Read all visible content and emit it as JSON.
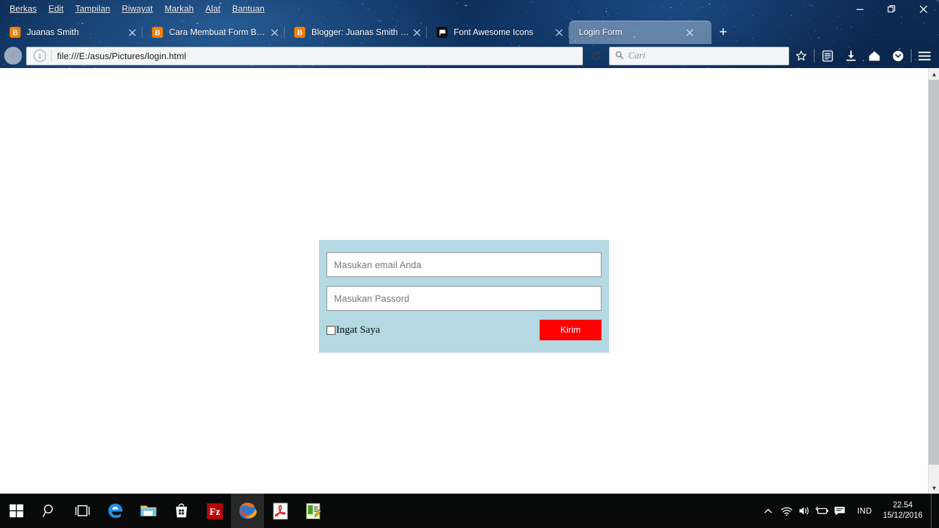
{
  "window": {
    "menus": [
      {
        "label": "Berkas",
        "accel": "B"
      },
      {
        "label": "Edit",
        "accel": "E"
      },
      {
        "label": "Tampilan",
        "accel": "T"
      },
      {
        "label": "Riwayat",
        "accel": "R"
      },
      {
        "label": "Markah",
        "accel": "M"
      },
      {
        "label": "Alat",
        "accel": "A"
      },
      {
        "label": "Bantuan",
        "accel": "n"
      }
    ],
    "controls": {
      "minimize": "minimize-icon",
      "restore": "restore-icon",
      "close": "close-icon"
    }
  },
  "tabs": [
    {
      "title": "Juanas Smith",
      "favicon": "blogger-icon",
      "active": false
    },
    {
      "title": "Cara Membuat Form Bead...",
      "favicon": "blogger-icon",
      "active": false
    },
    {
      "title": "Blogger: Juanas Smith - T...",
      "favicon": "blogger-icon",
      "active": false
    },
    {
      "title": "Font Awesome Icons",
      "favicon": "flag-icon",
      "active": false
    },
    {
      "title": "Login Form",
      "favicon": "none",
      "active": true
    }
  ],
  "newtab_label": "+",
  "toolbar": {
    "back_icon": "back-arrow-icon",
    "identity_icon": "info-icon",
    "url": "file:///E:/asus/Pictures/login.html",
    "reload_icon": "reload-icon",
    "search_placeholder": "Cari",
    "search_value": "",
    "icons": [
      {
        "name": "bookmark-star-icon",
        "glyph": "star"
      },
      {
        "name": "library-icon",
        "glyph": "library"
      },
      {
        "name": "downloads-icon",
        "glyph": "download"
      },
      {
        "name": "home-icon",
        "glyph": "home"
      },
      {
        "name": "pocket-icon",
        "glyph": "pocket"
      },
      {
        "name": "menu-hamburger-icon",
        "glyph": "hamburger"
      }
    ]
  },
  "page": {
    "panel_bg": "#b4d9e3",
    "email": {
      "placeholder": "Masukan email Anda",
      "value": ""
    },
    "password": {
      "placeholder": "Masukan Passord",
      "value": ""
    },
    "remember": {
      "label": "Ingat Saya",
      "checked": false
    },
    "submit": {
      "label": "Kirim",
      "color": "#ff0000"
    }
  },
  "scrollbar": {
    "up_arrow": "▲",
    "down_arrow": "▼"
  },
  "taskbar": {
    "items": [
      {
        "name": "start-button",
        "label": "Start"
      },
      {
        "name": "search-button",
        "label": "Search"
      },
      {
        "name": "task-view-button",
        "label": "Task View"
      },
      {
        "name": "edge-button",
        "label": "Microsoft Edge"
      },
      {
        "name": "file-explorer-button",
        "label": "File Explorer"
      },
      {
        "name": "store-button",
        "label": "Microsoft Store"
      },
      {
        "name": "filezilla-button",
        "label": "FileZilla"
      },
      {
        "name": "firefox-button",
        "label": "Mozilla Firefox"
      },
      {
        "name": "acrobat-button",
        "label": "Adobe Reader"
      },
      {
        "name": "notepad-button",
        "label": "Notepad"
      }
    ],
    "tray": {
      "chevron": "show-hidden-icons",
      "wifi": "wifi-icon",
      "volume": "volume-icon",
      "battery": "battery-icon",
      "action_center": "action-center-icon",
      "language": "IND",
      "time": "22.54",
      "date": "15/12/2016"
    }
  }
}
